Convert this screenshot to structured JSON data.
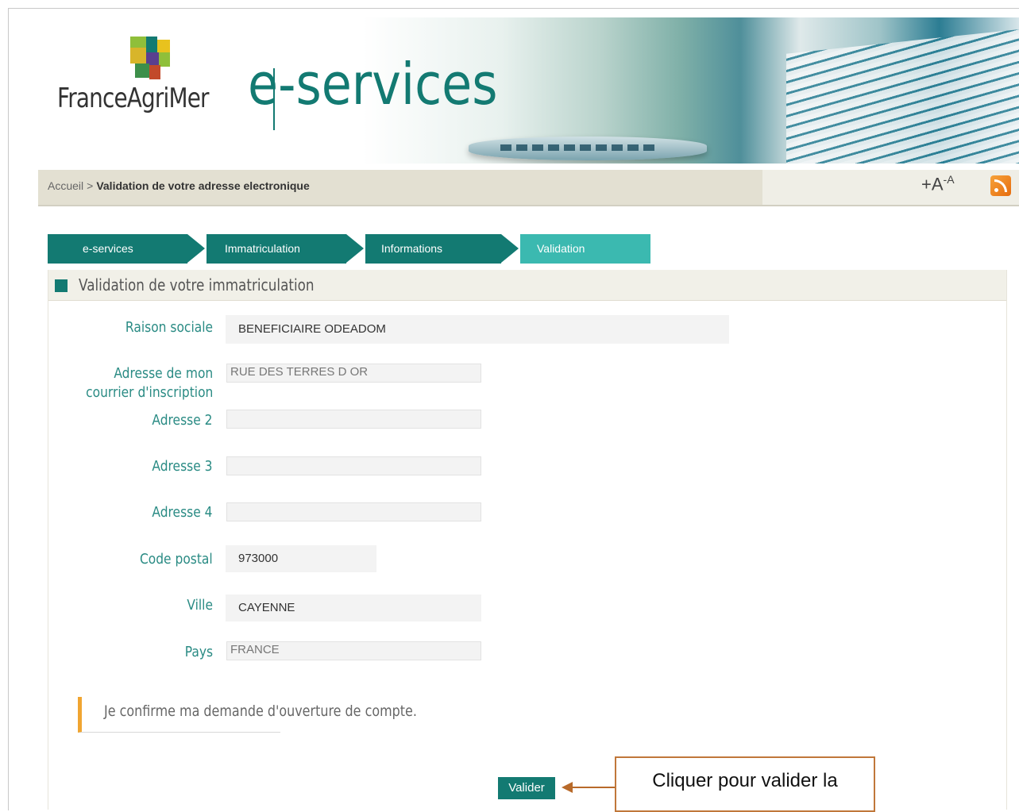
{
  "header": {
    "logo_text": "FranceAgriMer",
    "brand": "e-services"
  },
  "breadcrumb": {
    "home": "Accueil",
    "separator": ">",
    "current": "Validation de votre adresse electronique"
  },
  "toolbar": {
    "font_increase": "+A",
    "font_decrease": "-A"
  },
  "steps": [
    {
      "label": "e-services",
      "active": false
    },
    {
      "label": "Immatriculation",
      "active": false
    },
    {
      "label": "Informations",
      "active": false
    },
    {
      "label": "Validation",
      "active": true
    }
  ],
  "panel": {
    "title": "Validation de votre immatriculation"
  },
  "form": {
    "raison_sociale": {
      "label": "Raison sociale",
      "value": "BENEFICIAIRE ODEADOM"
    },
    "adresse1": {
      "label_line1": "Adresse de mon",
      "label_line2": "courrier d'inscription",
      "value": "RUE DES TERRES D OR"
    },
    "adresse2": {
      "label": "Adresse 2",
      "value": ""
    },
    "adresse3": {
      "label": "Adresse 3",
      "value": ""
    },
    "adresse4": {
      "label": "Adresse 4",
      "value": ""
    },
    "code_postal": {
      "label": "Code postal",
      "value": "973000"
    },
    "ville": {
      "label": "Ville",
      "value": "CAYENNE"
    },
    "pays": {
      "label": "Pays",
      "value": "FRANCE"
    }
  },
  "confirm_text": "Je confirme ma demande d'ouverture de compte.",
  "submit_label": "Valider",
  "callout_text": "Cliquer pour valider la",
  "colors": {
    "brand_green": "#137a72",
    "active_step": "#3bb9b0",
    "label_teal": "#2a8b84",
    "accent_orange": "#f0a531",
    "callout_border": "#c0773a"
  }
}
